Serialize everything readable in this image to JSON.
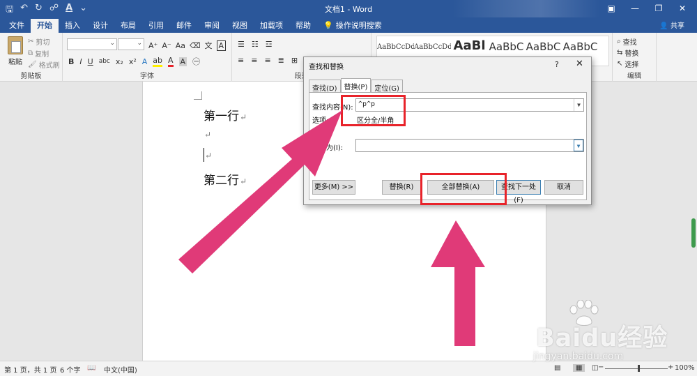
{
  "window": {
    "title": "文档1 - Word",
    "share": "共享"
  },
  "ribbon_tabs": [
    "文件",
    "开始",
    "插入",
    "设计",
    "布局",
    "引用",
    "邮件",
    "审阅",
    "视图",
    "加载项",
    "帮助",
    "操作说明搜索"
  ],
  "clipboard": {
    "paste": "粘贴",
    "cut": "剪切",
    "copy": "复制",
    "format_painter": "格式刷",
    "label": "剪贴板"
  },
  "font_group": {
    "label": "字体"
  },
  "paragraph_group": {
    "label": "段落"
  },
  "styles": [
    "AaBbCcDd",
    "AaBbCcDd",
    "AaBl",
    "AaBbC",
    "AaBbC",
    "AaBbC"
  ],
  "editing": {
    "find": "查找",
    "replace": "替换",
    "select": "选择",
    "label": "编辑"
  },
  "document": {
    "lines": [
      "第一行",
      "",
      "",
      "第二行"
    ],
    "para_mark": "↵"
  },
  "dialog": {
    "title": "查找和替换",
    "help": "?",
    "close": "✕",
    "tabs": [
      "查找(D)",
      "替换(P)",
      "定位(G)"
    ],
    "find_label": "查找内容(N):",
    "find_value": "^p^p",
    "options_label": "选项:",
    "options_value": "区分全/半角",
    "replace_label": "替换为(I):",
    "replace_value": "",
    "buttons": {
      "more": "更多(M) >>",
      "replace": "替换(R)",
      "replace_all": "全部替换(A)",
      "find_next": "查找下一处(F)",
      "cancel": "取消"
    }
  },
  "status": {
    "page": "第 1 页，共 1 页",
    "words": "6 个字",
    "language": "中文(中国)",
    "zoom": "100%"
  },
  "watermark": {
    "brand": "Baidu经验",
    "url": "jingyan.baidu.com"
  },
  "colors": {
    "ribbon_blue": "#2b579a",
    "arrow_pink": "#e03a78",
    "highlight_red": "#e8232a"
  }
}
